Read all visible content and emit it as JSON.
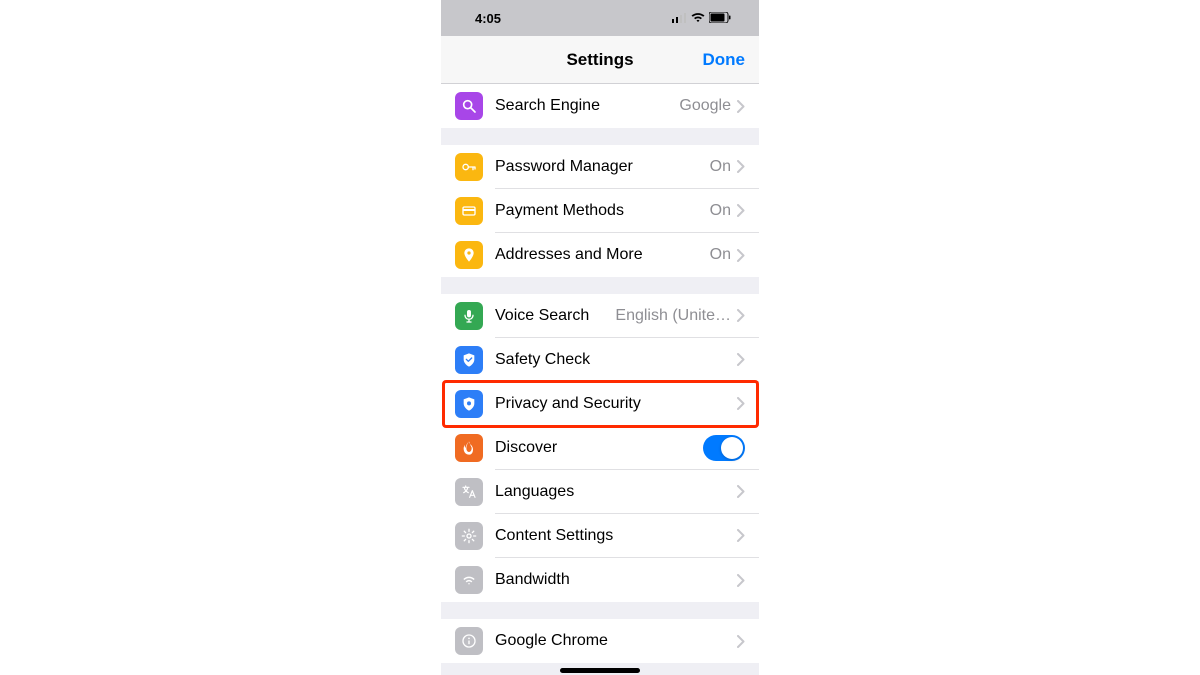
{
  "status": {
    "time": "4:05"
  },
  "header": {
    "title": "Settings",
    "done": "Done"
  },
  "sections": [
    {
      "rows": [
        {
          "name": "search-engine",
          "icon": "search-icon",
          "iconColor": "#a846e8",
          "label": "Search Engine",
          "value": "Google",
          "chevron": true
        }
      ]
    },
    {
      "rows": [
        {
          "name": "password-manager",
          "icon": "key-icon",
          "iconColor": "#fbb710",
          "label": "Password Manager",
          "value": "On",
          "chevron": true
        },
        {
          "name": "payment-methods",
          "icon": "card-icon",
          "iconColor": "#fbb710",
          "label": "Payment Methods",
          "value": "On",
          "chevron": true
        },
        {
          "name": "addresses-and-more",
          "icon": "location-icon",
          "iconColor": "#fbb710",
          "label": "Addresses and More",
          "value": "On",
          "chevron": true
        }
      ]
    },
    {
      "rows": [
        {
          "name": "voice-search",
          "icon": "mic-icon",
          "iconColor": "#34a853",
          "label": "Voice Search",
          "value": "English (Unite…",
          "chevron": true
        },
        {
          "name": "safety-check",
          "icon": "shield-check-icon",
          "iconColor": "#2d7ef7",
          "label": "Safety Check",
          "value": "",
          "chevron": true
        },
        {
          "name": "privacy-and-security",
          "icon": "shield-icon",
          "iconColor": "#2d7ef7",
          "label": "Privacy and Security",
          "value": "",
          "chevron": true,
          "highlighted": true
        },
        {
          "name": "discover",
          "icon": "fire-icon",
          "iconColor": "#f06b22",
          "label": "Discover",
          "toggle": true
        },
        {
          "name": "languages",
          "icon": "translate-icon",
          "iconColor": "#bfbfc4",
          "label": "Languages",
          "value": "",
          "chevron": true
        },
        {
          "name": "content-settings",
          "icon": "gear-icon",
          "iconColor": "#bfbfc4",
          "label": "Content Settings",
          "value": "",
          "chevron": true
        },
        {
          "name": "bandwidth",
          "icon": "wifi-icon",
          "iconColor": "#bfbfc4",
          "label": "Bandwidth",
          "value": "",
          "chevron": true
        }
      ]
    },
    {
      "rows": [
        {
          "name": "google-chrome",
          "icon": "info-icon",
          "iconColor": "#bfbfc4",
          "label": "Google Chrome",
          "value": "",
          "chevron": true
        }
      ]
    }
  ]
}
